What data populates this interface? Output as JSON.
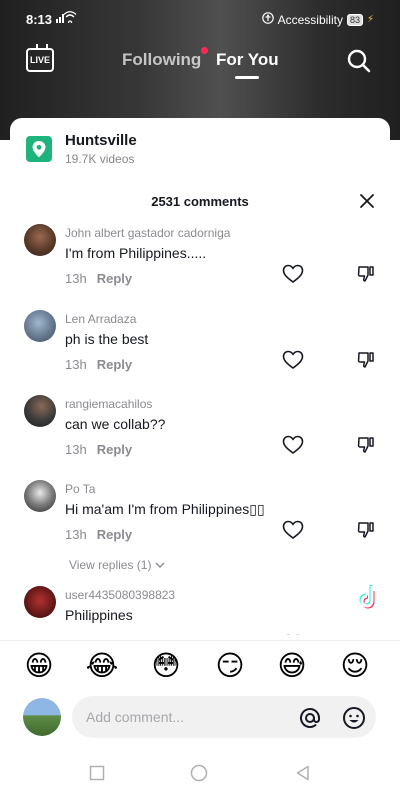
{
  "status_bar": {
    "time": "8:13",
    "signal": "📶",
    "accessibility_label": "Accessibility",
    "battery_level": "83"
  },
  "topnav": {
    "live_label": "LIVE",
    "following_label": "Following",
    "for_you_label": "For You"
  },
  "location": {
    "name": "Huntsville",
    "videos": "19.7K videos"
  },
  "comments_header": {
    "count_label": "2531 comments"
  },
  "comments": [
    {
      "username": "John albert gastador cadorniga",
      "text": "I'm from Philippines.....",
      "time": "13h",
      "reply_label": "Reply"
    },
    {
      "username": "Len Arradaza",
      "text": "ph is the best",
      "time": "13h",
      "reply_label": "Reply"
    },
    {
      "username": "rangiemacahilos",
      "text": "can we collab??",
      "time": "13h",
      "reply_label": "Reply"
    },
    {
      "username": "Po Ta",
      "text": "Hi ma'am I'm from Philippines▯▯",
      "time": "13h",
      "reply_label": "Reply"
    },
    {
      "username": "user4435080398823",
      "text": "Philippines",
      "time": "",
      "reply_label": ""
    }
  ],
  "view_replies_label": "View replies (1)",
  "watermark": {
    "brand": "TikTok",
    "handle": "@...58"
  },
  "emoji_row": [
    "😁",
    "😂",
    "😳",
    "😏",
    "😅",
    "😌"
  ],
  "comment_input": {
    "placeholder": "Add comment..."
  },
  "colors": {
    "accent_red": "#fe2c55",
    "location_green": "#1fb47d",
    "text_primary": "#161823",
    "text_secondary": "#8a8b91"
  }
}
